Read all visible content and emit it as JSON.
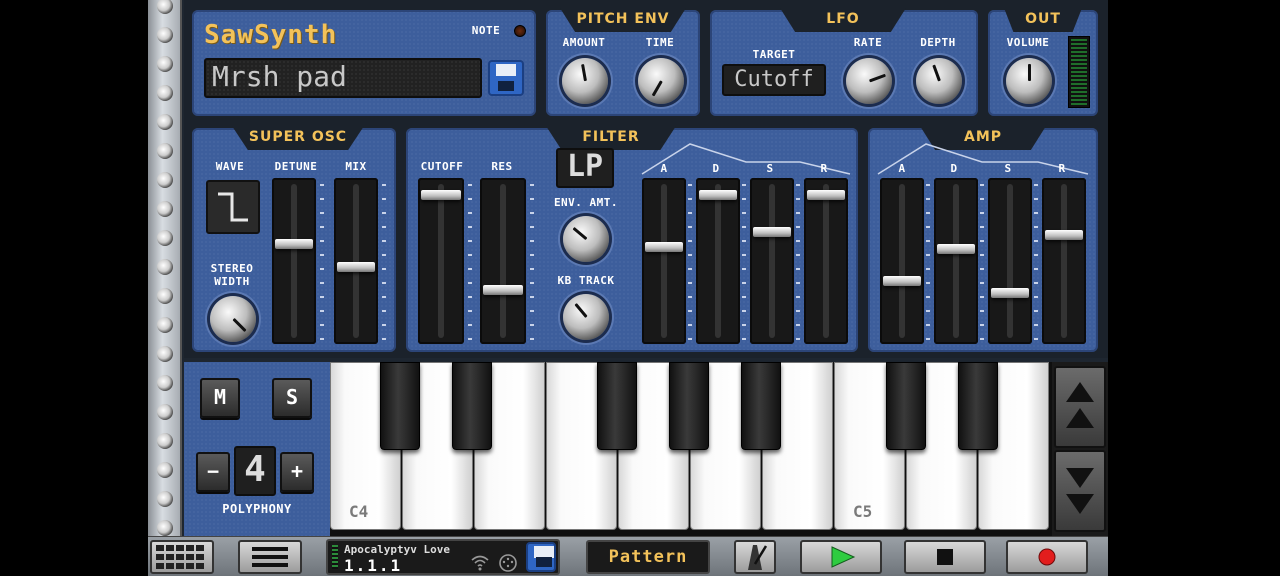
{
  "synth": {
    "brand": "SawSynth",
    "note_label": "NOTE",
    "preset_name": "Mrsh pad"
  },
  "pitch_env": {
    "title": "PITCH ENV",
    "amount_label": "AMOUNT",
    "time_label": "TIME"
  },
  "lfo": {
    "title": "LFO",
    "target_label": "TARGET",
    "target_value": "Cutoff",
    "rate_label": "RATE",
    "depth_label": "DEPTH"
  },
  "out": {
    "title": "OUT",
    "volume_label": "VOLUME"
  },
  "super_osc": {
    "title": "SUPER OSC",
    "wave_label": "WAVE",
    "detune_label": "DETUNE",
    "mix_label": "MIX",
    "stereo_label": "STEREO",
    "width_label": "WIDTH",
    "detune_level": 0.62,
    "mix_level": 0.46
  },
  "filter": {
    "title": "FILTER",
    "cutoff_label": "CUTOFF",
    "res_label": "RES",
    "mode": "LP",
    "env_amt_label": "ENV. AMT.",
    "kb_track_label": "KB TRACK",
    "cutoff_level": 0.96,
    "res_level": 0.3,
    "env": {
      "a_label": "A",
      "d_label": "D",
      "s_label": "S",
      "r_label": "R",
      "a": 0.6,
      "d": 0.96,
      "s": 0.7,
      "r": 0.96
    }
  },
  "amp": {
    "title": "AMP",
    "a_label": "A",
    "d_label": "D",
    "s_label": "S",
    "r_label": "R",
    "a": 0.36,
    "d": 0.58,
    "s": 0.28,
    "r": 0.68
  },
  "keyboard": {
    "mute_label": "M",
    "solo_label": "S",
    "minus_label": "−",
    "plus_label": "+",
    "polyphony_value": "4",
    "polyphony_label": "POLYPHONY",
    "c4_label": "C4",
    "c5_label": "C5"
  },
  "toolbar": {
    "song_title": "Apocalyptyv Love",
    "position": "1.1.1",
    "pattern_label": "Pattern"
  },
  "colors": {
    "panel": "#3d5e9c",
    "accent": "#f3c25a",
    "play": "#2ecc40",
    "record": "#e21d1d"
  }
}
